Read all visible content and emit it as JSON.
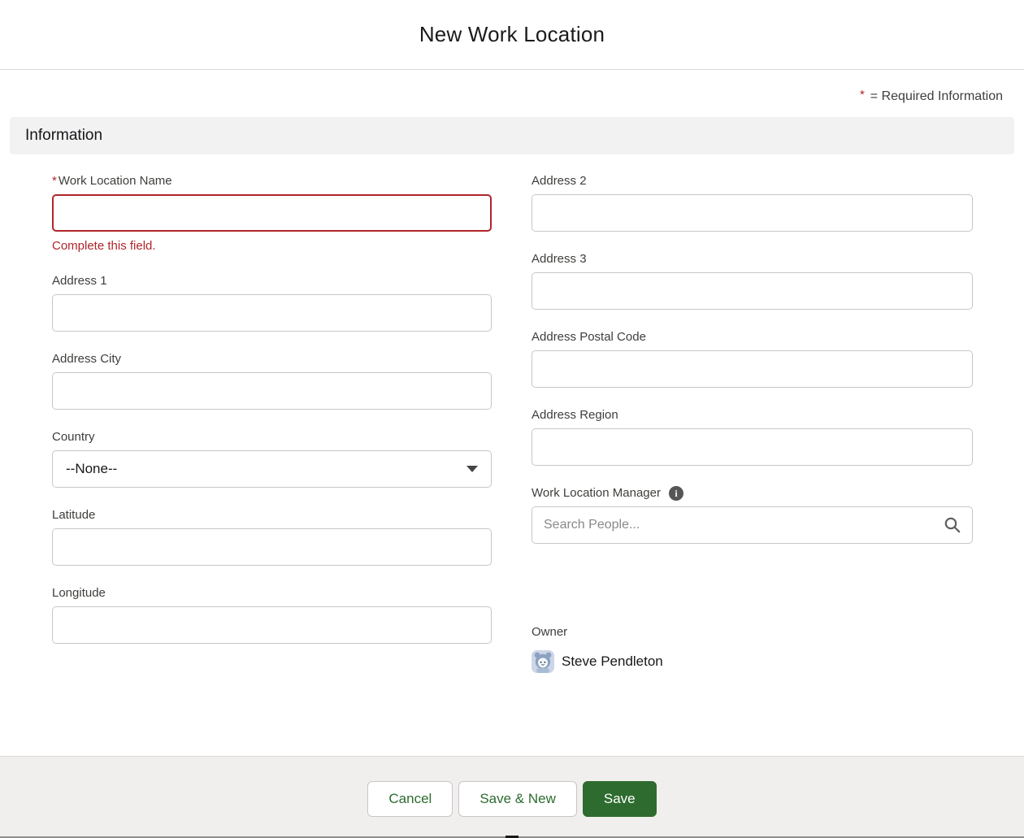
{
  "dialog": {
    "title": "New Work Location",
    "required_legend": {
      "asterisk": "*",
      "text": "= Required Information"
    },
    "section_title": "Information"
  },
  "fields": {
    "work_location_name": {
      "label": "Work Location Name",
      "required": true,
      "value": "",
      "error": "Complete this field."
    },
    "address1": {
      "label": "Address 1",
      "value": ""
    },
    "address_city": {
      "label": "Address City",
      "value": ""
    },
    "country": {
      "label": "Country",
      "selected": "--None--"
    },
    "latitude": {
      "label": "Latitude",
      "value": ""
    },
    "longitude": {
      "label": "Longitude",
      "value": ""
    },
    "address2": {
      "label": "Address 2",
      "value": ""
    },
    "address3": {
      "label": "Address 3",
      "value": ""
    },
    "address_postal_code": {
      "label": "Address Postal Code",
      "value": ""
    },
    "address_region": {
      "label": "Address Region",
      "value": ""
    },
    "work_location_manager": {
      "label": "Work Location Manager",
      "value": "",
      "placeholder": "Search People..."
    }
  },
  "owner": {
    "label": "Owner",
    "name": "Steve Pendleton"
  },
  "footer": {
    "cancel_label": "Cancel",
    "save_new_label": "Save & New",
    "save_label": "Save"
  },
  "icons": {
    "info_glyph": "i"
  },
  "colors": {
    "error": "#B0252B",
    "green": "#2E6B2F"
  }
}
